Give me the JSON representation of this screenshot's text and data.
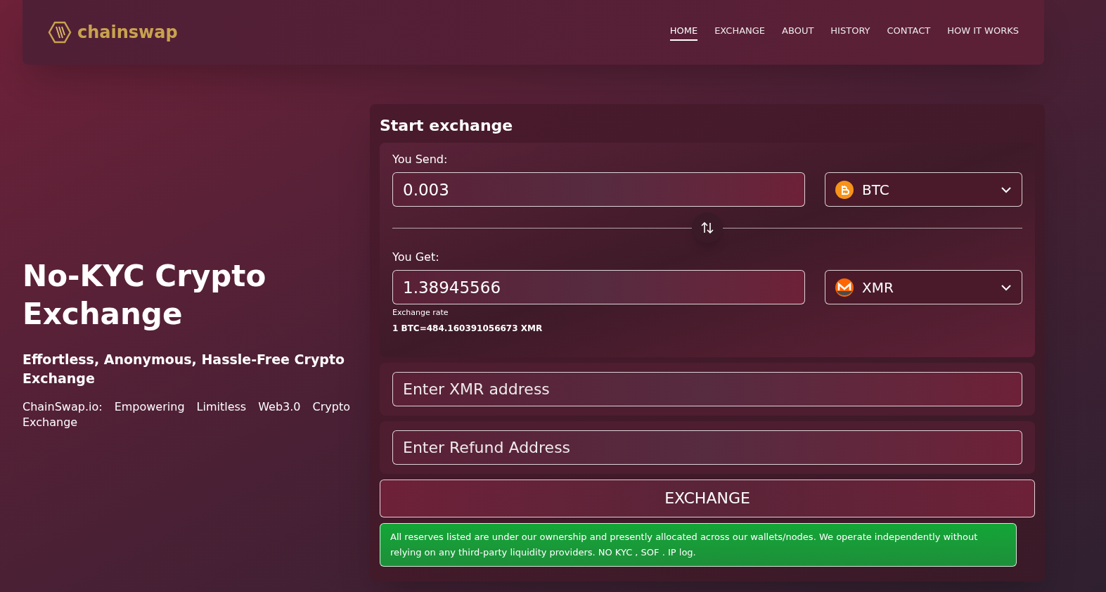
{
  "header": {
    "logo_text": "chainswap",
    "nav": [
      {
        "label": "HOME",
        "selected": true
      },
      {
        "label": "EXCHANGE",
        "selected": false
      },
      {
        "label": "ABOUT",
        "selected": false
      },
      {
        "label": "HISTORY",
        "selected": false
      },
      {
        "label": "CONTACT",
        "selected": false
      },
      {
        "label": "HOW IT WORKS",
        "selected": false
      }
    ]
  },
  "hero": {
    "title": "No-KYC Crypto Exchange",
    "subtitle": "Effortless, Anonymous, Hassle-Free Crypto Exchange",
    "description": "ChainSwap.io: Empowering Limitless Web3.0 Crypto Exchange"
  },
  "exchange": {
    "title": "Start exchange",
    "send": {
      "label": "You Send:",
      "value": "0.003",
      "currency": "BTC"
    },
    "get": {
      "label": "You Get:",
      "value": "1.38945566",
      "currency": "XMR"
    },
    "rate_label": "Exchange rate",
    "rate": "1 BTC=484.160391056673 XMR",
    "address": {
      "placeholder": "Enter XMR address"
    },
    "refund": {
      "placeholder": "Enter Refund Address"
    },
    "button": "EXCHANGE",
    "notice": "All reserves listed are under our ownership and presently allocated across our wallets/nodes. We operate independently without relying on any third-party liquidity providers. NO KYC , SOF . IP log."
  }
}
